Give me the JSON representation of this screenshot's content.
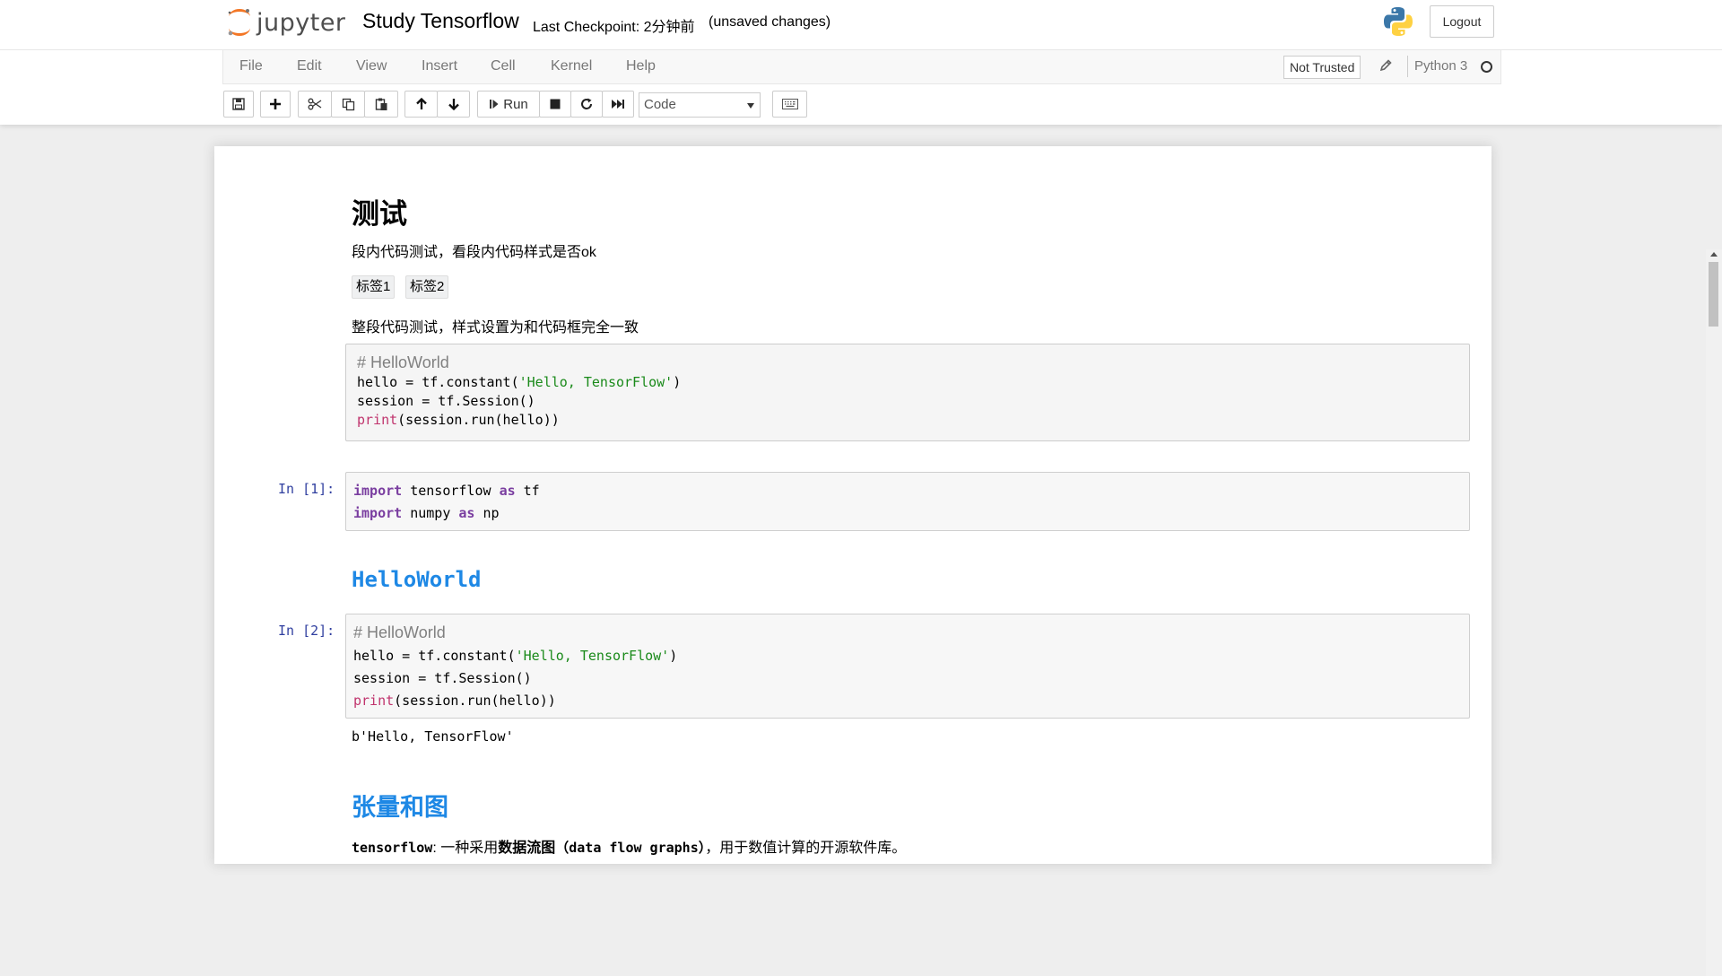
{
  "header": {
    "logo_text": "jupyter",
    "notebook_name": "Study Tensorflow",
    "checkpoint": "Last Checkpoint: 2分钟前",
    "autosave": "(unsaved changes)",
    "logout": "Logout"
  },
  "menubar": {
    "items": [
      "File",
      "Edit",
      "View",
      "Insert",
      "Cell",
      "Kernel",
      "Help"
    ],
    "not_trusted": "Not Trusted",
    "kernel_name": "Python 3"
  },
  "toolbar": {
    "run_label": "Run",
    "cell_type": "Code",
    "icons": [
      "save-icon",
      "plus-icon",
      "cut-icon",
      "copy-icon",
      "paste-icon",
      "arrow-up-icon",
      "arrow-down-icon",
      "run-icon",
      "stop-icon",
      "restart-icon",
      "fast-forward-icon",
      "keyboard-icon"
    ]
  },
  "cells": {
    "heading1": "测试",
    "inline_test": "段内代码测试，看段内代码样式是否ok",
    "tags": [
      "标签1",
      "标签2"
    ],
    "block_test": "整段代码测试，样式设置为和代码框完全一致",
    "md_code": {
      "comment": "# HelloWorld",
      "l1_a": "hello = tf.constant(",
      "l1_str": "'Hello, TensorFlow'",
      "l1_b": ")",
      "l2": "session = tf.Session()",
      "l3_print": "print",
      "l3_rest": "(session.run(hello))"
    },
    "cell1": {
      "prompt": "In [1]:",
      "line1_kw1": "import",
      "line1_mid": " tensorflow ",
      "line1_kw2": "as",
      "line1_end": " tf",
      "line2_kw1": "import",
      "line2_mid": " numpy ",
      "line2_kw2": "as",
      "line2_end": " np"
    },
    "heading_hello": "HelloWorld",
    "cell2": {
      "prompt": "In [2]:",
      "comment": "# HelloWorld",
      "l1_a": "hello = tf.constant(",
      "l1_str": "'Hello, TensorFlow'",
      "l1_b": ")",
      "l2": "session = tf.Session()",
      "l3_print": "print",
      "l3_rest": "(session.run(hello))",
      "output": "b'Hello, TensorFlow'"
    },
    "heading_tensor": "张量和图",
    "last_para": {
      "code": "tensorflow",
      "text1": ": 一种采用",
      "bold": "数据流图",
      "code2": "（data flow graphs）",
      "text2": "，用于数值计算的开源软件库。"
    }
  },
  "colors": {
    "accent_blue": "#1e88e5",
    "keyword": "#7a3ea0",
    "string": "#1a8a1a",
    "builtin": "#c0346d",
    "prompt": "#303f9f"
  }
}
